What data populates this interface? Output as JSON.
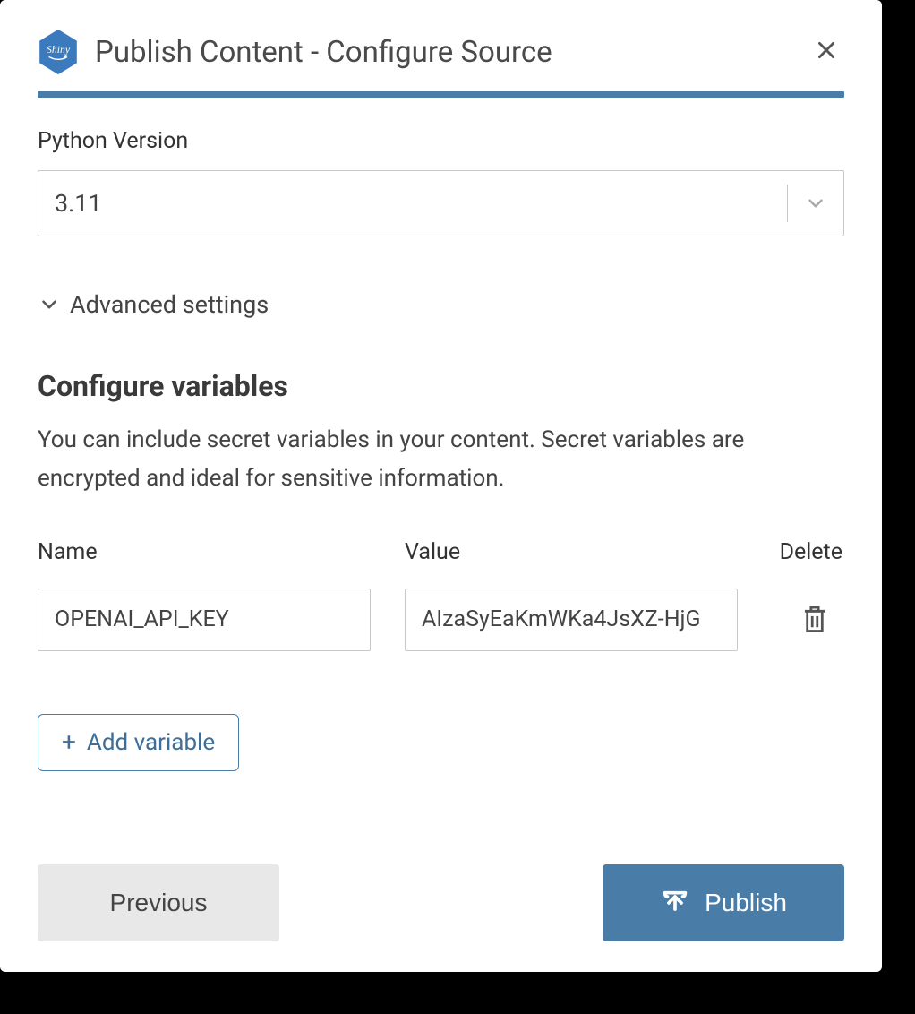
{
  "header": {
    "title": "Publish Content - Configure Source",
    "logo_text": "Shiny"
  },
  "python": {
    "label": "Python Version",
    "selected": "3.11"
  },
  "advanced": {
    "label": "Advanced settings"
  },
  "variables_section": {
    "title": "Configure variables",
    "description": "You can include secret variables in your content. Secret variables are encrypted and ideal for sensitive information.",
    "headers": {
      "name": "Name",
      "value": "Value",
      "delete": "Delete"
    },
    "rows": [
      {
        "name": "OPENAI_API_KEY",
        "value": "AIzaSyEaKmWKa4JsXZ-HjG"
      }
    ],
    "add_label": "Add variable"
  },
  "footer": {
    "previous": "Previous",
    "publish": "Publish"
  },
  "colors": {
    "brand": "#4a7ca8",
    "logo": "#3b7bbd"
  }
}
